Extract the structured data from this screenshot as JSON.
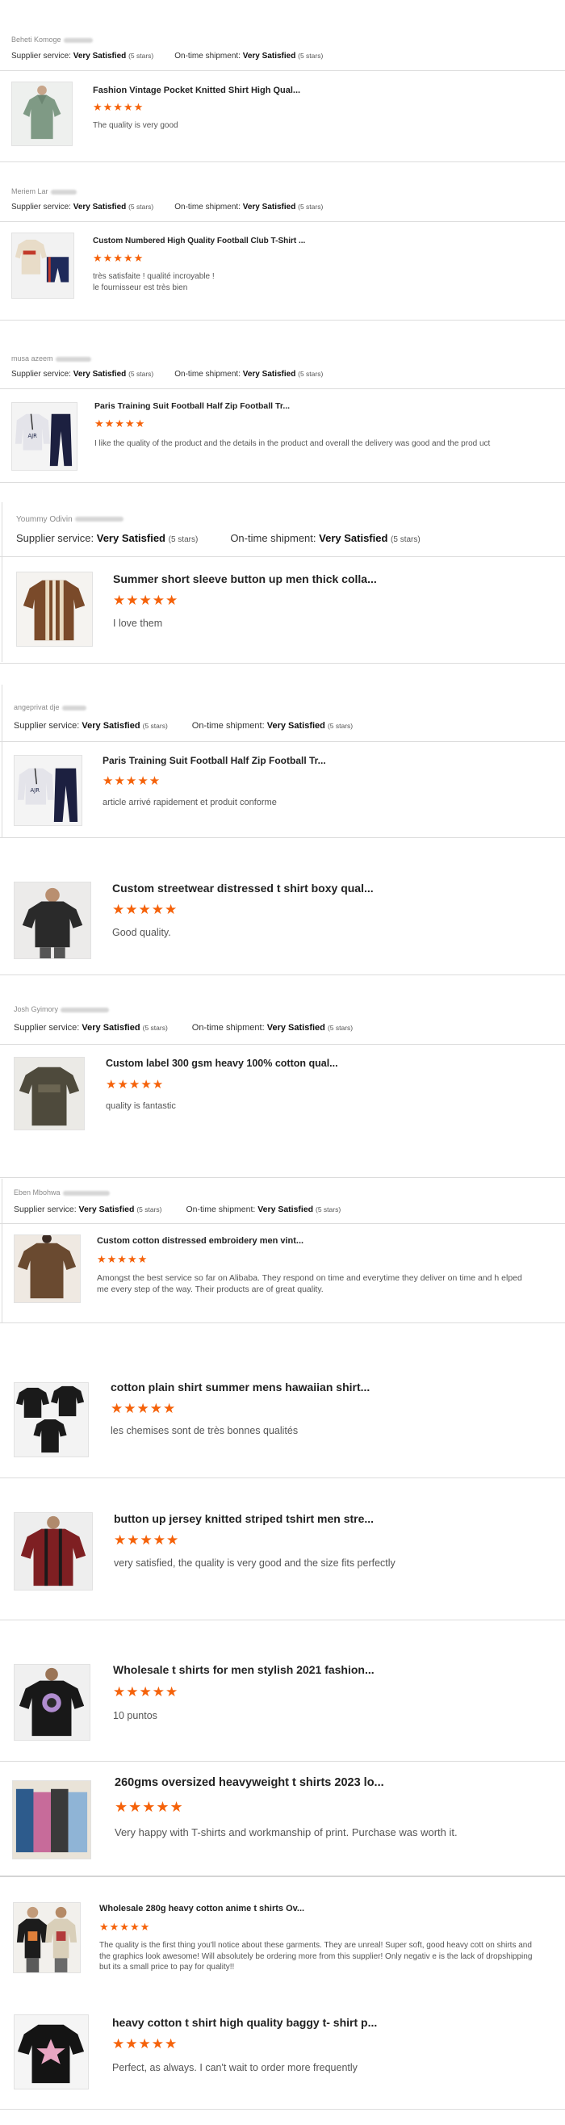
{
  "labels": {
    "supplier": "Supplier service:",
    "shipment": "On-time shipment:",
    "very_satisfied": "Very Satisfied",
    "five_stars": "(5 stars)",
    "star_glyphs": "★★★★★"
  },
  "colors": {
    "star": "#f5620a",
    "separator": "#dcdcdc"
  },
  "reviews": [
    {
      "author": "Beheti Komoge",
      "product": "Fashion Vintage Pocket Knitted Shirt High Qual...",
      "rating": 5,
      "comment": "The quality is very good",
      "icon": "green-polo-shirt-icon"
    },
    {
      "author": "Meriem Lar",
      "product": "Custom Numbered High Quality Football Club T-Shirt ...",
      "rating": 5,
      "comment": "très satisfaite ! qualité incroyable !\nle fournisseur est très bien",
      "icon": "football-kit-icon"
    },
    {
      "author": "musa azeem",
      "product": "Paris Training Suit Football Half Zip Football Tr...",
      "rating": 5,
      "comment": "I like the quality of the product and the details in the product and overall the delivery was good and the prod uct",
      "icon": "training-suit-icon"
    },
    {
      "author": "Yoummy Odivin",
      "product": "Summer short sleeve button up men thick colla...",
      "rating": 5,
      "comment": "I love them",
      "icon": "striped-button-shirt-icon"
    },
    {
      "author": "angeprivat dje",
      "product": "Paris Training Suit Football Half Zip Football Tr...",
      "rating": 5,
      "comment": "article arrivé rapidement et produit conforme",
      "icon": "training-suit-icon"
    },
    {
      "author": "",
      "product": "Custom streetwear distressed t shirt boxy qual...",
      "rating": 5,
      "comment": "Good quality.",
      "icon": "distressed-tshirt-icon"
    },
    {
      "author": "Josh Gyimory",
      "product": "Custom label 300 gsm heavy 100% cotton qual...",
      "rating": 5,
      "comment": "quality is fantastic",
      "icon": "heavy-tshirt-icon"
    },
    {
      "author": "Eben Mbohwa",
      "product": "Custom cotton distressed embroidery men vint...",
      "rating": 5,
      "comment": "Amongst the best service so far on Alibaba. They respond on time and everytime they deliver on time and h elped me every step of the way. Their products are of great quality.",
      "icon": "brown-tshirt-icon"
    },
    {
      "author": "",
      "product": "cotton plain shirt summer mens hawaiian shirt...",
      "rating": 5,
      "comment": "les chemises sont de très bonnes qualités",
      "icon": "black-shirts-icon"
    },
    {
      "author": "",
      "product": "button up jersey knitted striped tshirt men stre...",
      "rating": 5,
      "comment": "very satisfied, the quality is very good and the size fits perfectly",
      "icon": "red-striped-shirt-icon"
    },
    {
      "author": "",
      "product": "Wholesale t shirts for men stylish 2021 fashion...",
      "rating": 5,
      "comment": "10 puntos",
      "icon": "graphic-tshirt-icon"
    },
    {
      "author": "",
      "product": "260gms oversized heavyweight t shirts 2023 lo...",
      "rating": 5,
      "comment": "Very happy with T-shirts and workmanship of print. Purchase was worth it.",
      "icon": "color-tshirts-icon"
    },
    {
      "author": "",
      "product": "Wholesale 280g heavy cotton anime t shirts Ov...",
      "rating": 5,
      "comment": "The quality is the first thing you'll notice about these garments. They are unreal! Super soft, good heavy cott on shirts and the graphics look awesome! Will absolutely be ordering more from this supplier! Only negativ e is the lack of dropshipping but its a small price to pay for quality!!",
      "icon": "anime-tshirt-icon"
    },
    {
      "author": "",
      "product": "heavy cotton t shirt high quality baggy t- shirt p...",
      "rating": 5,
      "comment": "Perfect, as always. I can't wait to order more frequently",
      "icon": "star-print-tshirt-icon"
    }
  ]
}
